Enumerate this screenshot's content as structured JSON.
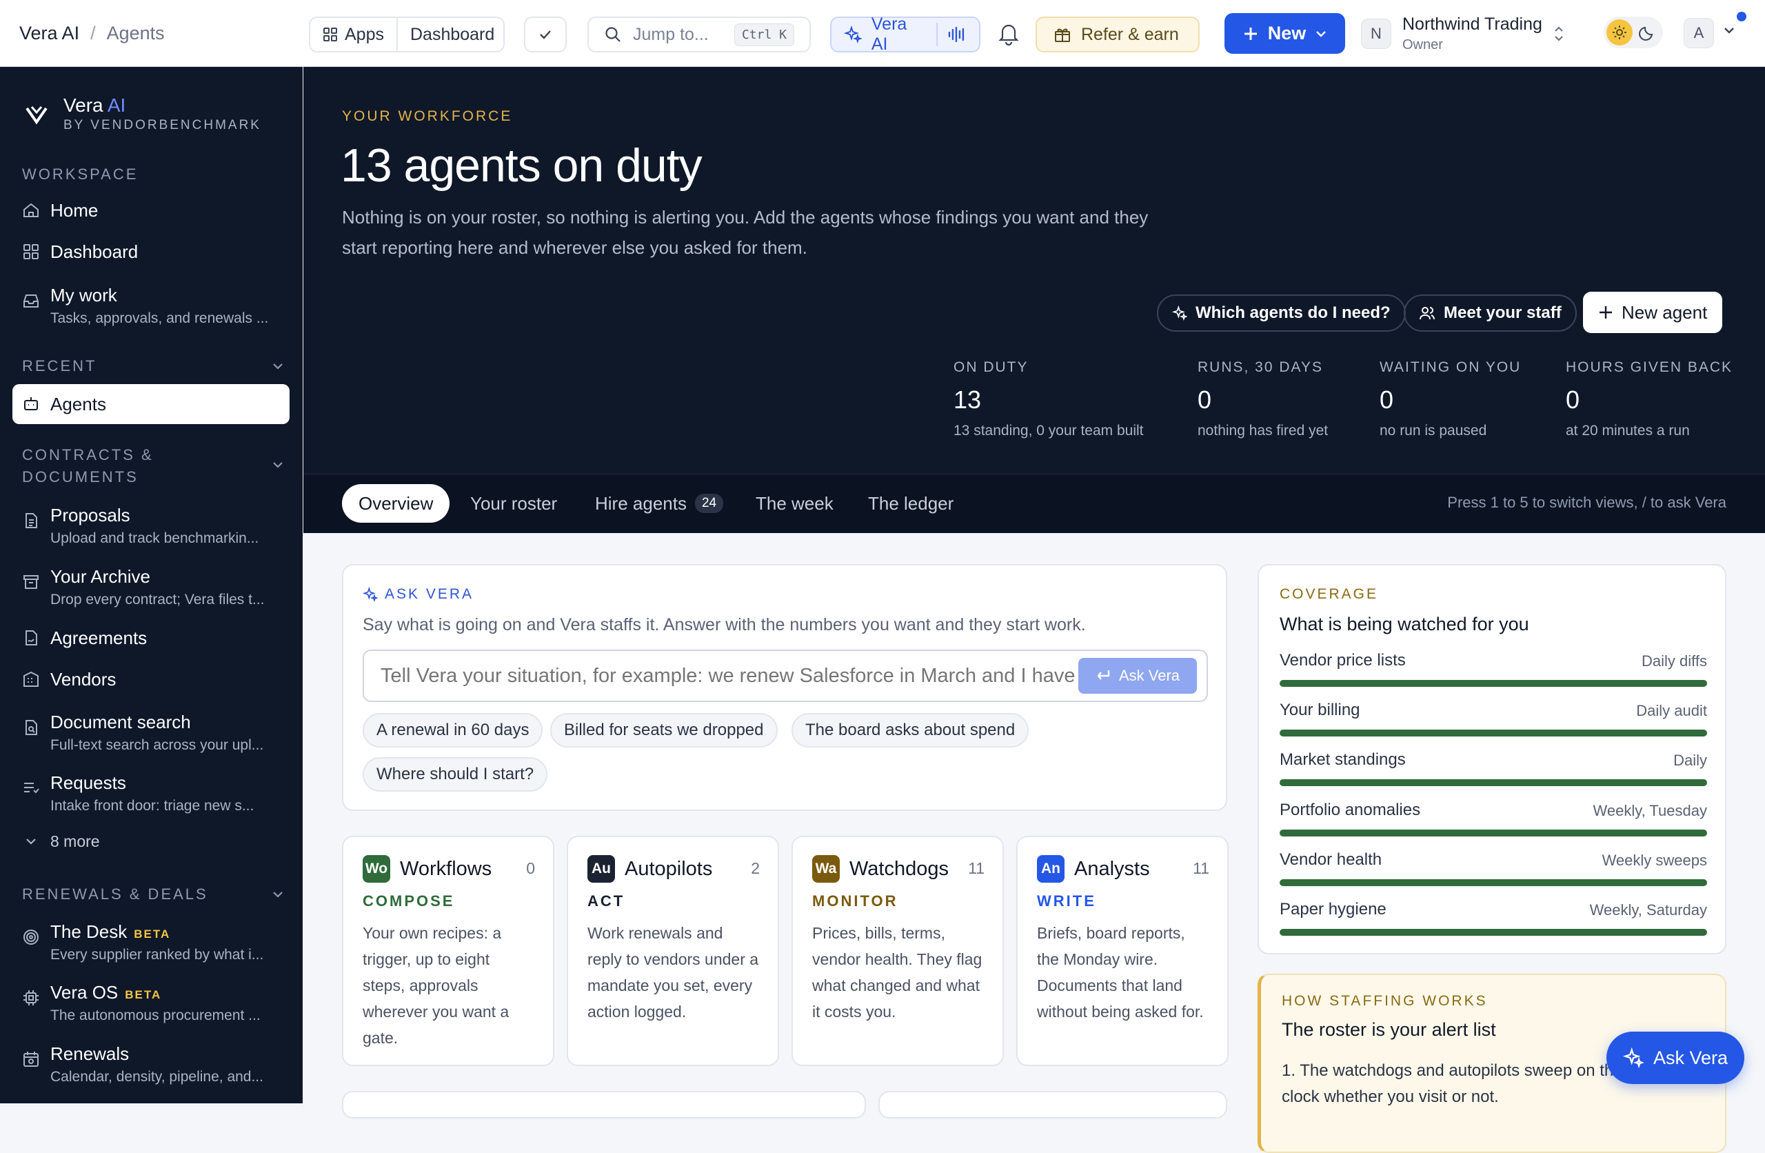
{
  "breadcrumb": {
    "root": "Vera AI",
    "current": "Agents"
  },
  "topbar": {
    "apps": "Apps",
    "dashboard": "Dashboard",
    "jump_placeholder": "Jump to...",
    "jump_kbd": "Ctrl K",
    "vera": "Vera AI",
    "refer": "Refer & earn",
    "new": "New",
    "org_initial": "N",
    "org_name": "Northwind Trading",
    "org_role": "Owner",
    "user_initial": "A"
  },
  "brand": {
    "name": "Vera",
    "ai": "AI",
    "by": "BY VENDORBENCHMARK"
  },
  "sidebar": {
    "workspace": "WORKSPACE",
    "home": "Home",
    "dashboard": "Dashboard",
    "mywork": "My work",
    "mywork_desc": "Tasks, approvals, and renewals ...",
    "recent": "RECENT",
    "agents": "Agents",
    "contracts": "CONTRACTS &",
    "contracts2": "DOCUMENTS",
    "proposals": "Proposals",
    "proposals_desc": "Upload and track benchmarkin...",
    "archive": "Your Archive",
    "archive_desc": "Drop every contract; Vera files t...",
    "agreements": "Agreements",
    "vendors": "Vendors",
    "docsearch": "Document search",
    "docsearch_desc": "Full-text search across your upl...",
    "requests": "Requests",
    "requests_desc": "Intake front door: triage new s...",
    "more": "8 more",
    "renewals_sec": "RENEWALS & DEALS",
    "desk": "The Desk",
    "desk_desc": "Every supplier ranked by what i...",
    "veraos": "Vera OS",
    "veraos_desc": "The autonomous procurement ...",
    "renewals": "Renewals",
    "renewals_desc": "Calendar, density, pipeline, and...",
    "beta": "BETA"
  },
  "hero": {
    "eyebrow": "YOUR WORKFORCE",
    "title": "13 agents on duty",
    "lede": "Nothing is on your roster, so nothing is alerting you. Add the agents whose findings you want and they start reporting here and wherever else you asked for them.",
    "btn_which": "Which agents do I need?",
    "btn_meet": "Meet your staff",
    "btn_new": "New agent",
    "stats": [
      {
        "k": "ON DUTY",
        "v": "13",
        "s": "13 standing, 0 your team built"
      },
      {
        "k": "RUNS, 30 DAYS",
        "v": "0",
        "s": "nothing has fired yet"
      },
      {
        "k": "WAITING ON YOU",
        "v": "0",
        "s": "no run is paused"
      },
      {
        "k": "HOURS GIVEN BACK",
        "v": "0",
        "s": "at 20 minutes a run"
      }
    ]
  },
  "tabs": {
    "overview": "Overview",
    "roster": "Your roster",
    "hire": "Hire agents",
    "hire_count": "24",
    "week": "The week",
    "ledger": "The ledger",
    "hint": "Press 1 to 5 to switch views, / to ask Vera"
  },
  "ask": {
    "eyebrow": "ASK VERA",
    "sub": "Say what is going on and Vera staffs it. Answer with the numbers you want and they start work.",
    "placeholder": "Tell Vera your situation, for example: we renew Salesforce in March and I have",
    "button": "Ask Vera",
    "chips": [
      "A renewal in 60 days",
      "Billed for seats we dropped",
      "The board asks about spend",
      "Where should I start?"
    ]
  },
  "kinds": [
    {
      "mono": "Wo",
      "name": "Workflows",
      "count": "0",
      "verb": "COMPOSE",
      "desc": "Your own recipes: a trigger, up to eight steps, approvals wherever you want a gate.",
      "color": "#2f6b3b"
    },
    {
      "mono": "Au",
      "name": "Autopilots",
      "count": "2",
      "verb": "ACT",
      "desc": "Work renewals and reply to vendors under a mandate you set, every action logged.",
      "color": "#1b2333"
    },
    {
      "mono": "Wa",
      "name": "Watchdogs",
      "count": "11",
      "verb": "MONITOR",
      "desc": "Prices, bills, terms, vendor health. They flag what changed and what it costs you.",
      "color": "#7a5a0e"
    },
    {
      "mono": "An",
      "name": "Analysts",
      "count": "11",
      "verb": "WRITE",
      "desc": "Briefs, board reports, the Monday wire. Documents that land without being asked for.",
      "color": "#2457e6"
    }
  ],
  "coverage": {
    "eyebrow": "COVERAGE",
    "title": "What is being watched for you",
    "rows": [
      {
        "label": "Vendor price lists",
        "freq": "Daily diffs"
      },
      {
        "label": "Your billing",
        "freq": "Daily audit"
      },
      {
        "label": "Market standings",
        "freq": "Daily"
      },
      {
        "label": "Portfolio anomalies",
        "freq": "Weekly, Tuesday"
      },
      {
        "label": "Vendor health",
        "freq": "Weekly sweeps"
      },
      {
        "label": "Paper hygiene",
        "freq": "Weekly, Saturday"
      }
    ]
  },
  "staffing": {
    "eyebrow": "HOW STAFFING WORKS",
    "title": "The roster is your alert list",
    "item1": "1. The watchdogs and autopilots sweep on the platform's clock whether you visit or not."
  },
  "fab": "Ask Vera"
}
